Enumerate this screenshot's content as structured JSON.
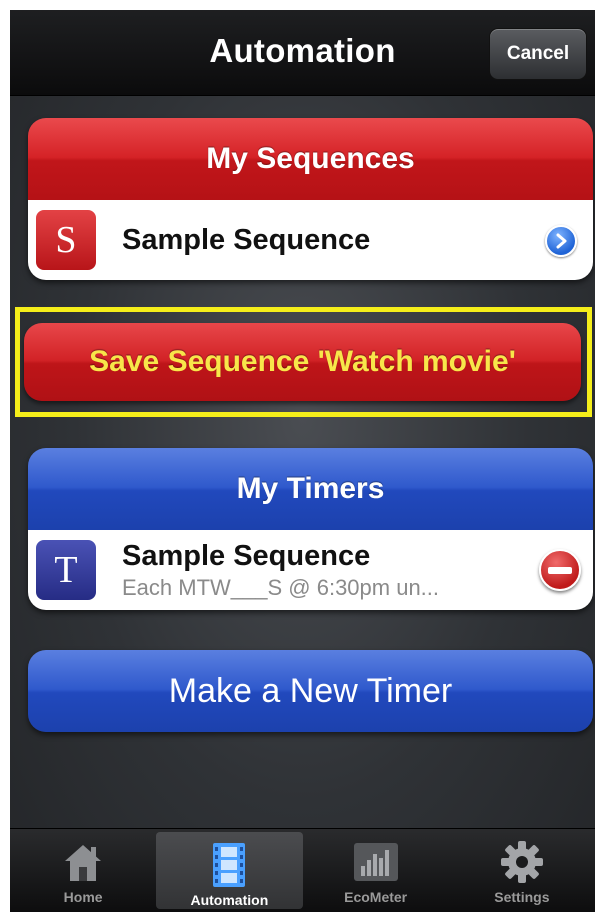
{
  "navbar": {
    "title": "Automation",
    "cancel_label": "Cancel"
  },
  "sequences_panel": {
    "header": "My Sequences",
    "items": [
      {
        "icon_letter": "S",
        "title": "Sample Sequence",
        "accessory": "disclosure-icon"
      }
    ]
  },
  "save_button": {
    "label": "Save Sequence 'Watch movie'",
    "highlight_color": "#f5ee1a"
  },
  "timers_panel": {
    "header": "My Timers",
    "items": [
      {
        "icon_letter": "T",
        "title": "Sample Sequence",
        "subtitle": "Each MTW___S @ 6:30pm un...",
        "accessory": "delete-icon"
      }
    ]
  },
  "new_timer_button": {
    "label": "Make a New Timer"
  },
  "tabbar": {
    "tabs": [
      {
        "label": "Home",
        "icon": "home-icon",
        "active": false
      },
      {
        "label": "Automation",
        "icon": "film-icon",
        "active": true
      },
      {
        "label": "EcoMeter",
        "icon": "bar-meter-icon",
        "active": false
      },
      {
        "label": "Settings",
        "icon": "gear-icon",
        "active": false
      }
    ]
  },
  "colors": {
    "red_accent": "#d52226",
    "blue_accent": "#2f59cc",
    "save_text": "#f8e64a"
  }
}
